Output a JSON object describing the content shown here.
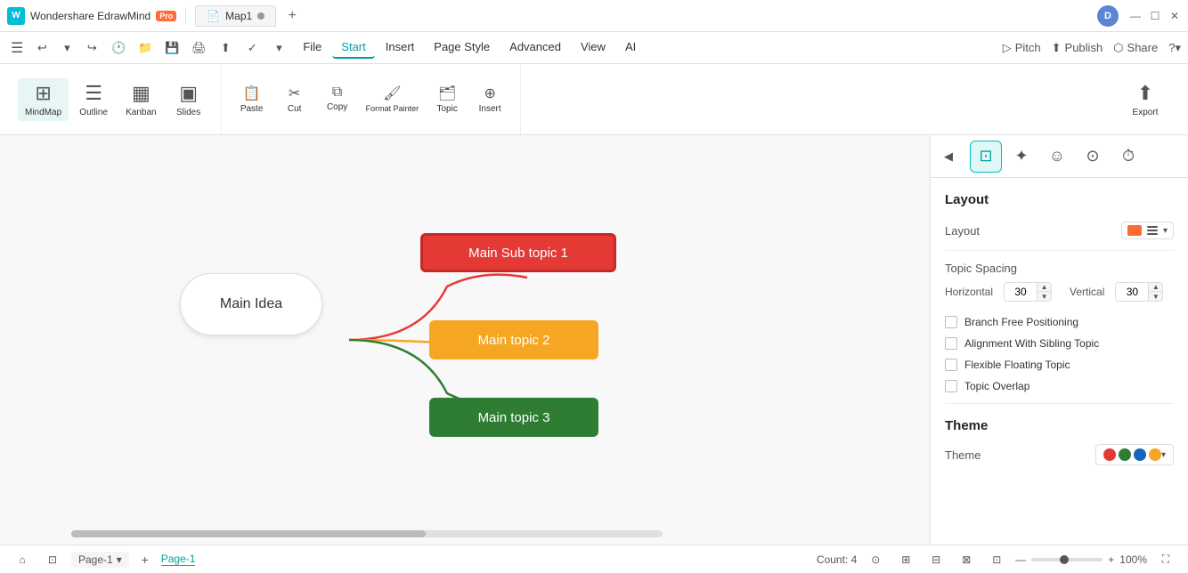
{
  "app": {
    "name": "Wondershare EdrawMind",
    "badge": "Pro",
    "file_tab": "Map1",
    "user_initial": "D"
  },
  "title_bar": {
    "win_minimize": "—",
    "win_maximize": "☐",
    "win_close": "✕"
  },
  "nav": {
    "items": [
      "File",
      "Start",
      "Insert",
      "Page Style",
      "Advanced",
      "View",
      "AI"
    ],
    "active": "Start",
    "actions": {
      "pitch": "Pitch",
      "publish": "Publish",
      "share": "Share"
    }
  },
  "ribbon": {
    "view_group": [
      {
        "id": "mindmap",
        "label": "MindMap",
        "icon": "⊞"
      },
      {
        "id": "outline",
        "label": "Outline",
        "icon": "☰"
      },
      {
        "id": "kanban",
        "label": "Kanban",
        "icon": "▦"
      },
      {
        "id": "slides",
        "label": "Slides",
        "icon": "▣"
      }
    ],
    "edit_group": [
      {
        "id": "paste",
        "label": "Paste",
        "icon": "📋"
      },
      {
        "id": "cut",
        "label": "Cut",
        "icon": "✂"
      },
      {
        "id": "copy",
        "label": "Copy",
        "icon": "⧉"
      },
      {
        "id": "format_painter",
        "label": "Format Painter",
        "icon": "🖌"
      },
      {
        "id": "topic",
        "label": "Topic",
        "icon": "🗂"
      },
      {
        "id": "insert",
        "label": "Insert",
        "icon": "⊕"
      }
    ],
    "export": "Export"
  },
  "canvas": {
    "nodes": {
      "main_idea": "Main Idea",
      "sub1": "Main Sub topic 1",
      "sub2": "Main topic 2",
      "sub3": "Main topic 3"
    }
  },
  "right_panel": {
    "tabs": [
      {
        "id": "layout",
        "icon": "⊡",
        "active": true
      },
      {
        "id": "ai",
        "icon": "✦"
      },
      {
        "id": "emoji",
        "icon": "☺"
      },
      {
        "id": "shield",
        "icon": "⊙"
      },
      {
        "id": "clock",
        "icon": "⏱"
      }
    ],
    "layout_section": {
      "title": "Layout",
      "layout_label": "Layout",
      "spacing_title": "Topic Spacing",
      "horizontal_label": "Horizontal",
      "horizontal_value": "30",
      "vertical_label": "Vertical",
      "vertical_value": "30",
      "checkboxes": [
        {
          "id": "branch_free",
          "label": "Branch Free Positioning",
          "checked": false
        },
        {
          "id": "alignment",
          "label": "Alignment With Sibling Topic",
          "checked": false
        },
        {
          "id": "flexible",
          "label": "Flexible Floating Topic",
          "checked": false
        },
        {
          "id": "topic_overlap",
          "label": "Topic Overlap",
          "checked": false
        }
      ]
    },
    "theme_section": {
      "title": "Theme",
      "theme_label": "Theme",
      "colors": [
        "#e53935",
        "#2e7d32",
        "#1565c0",
        "#f5a623"
      ]
    }
  },
  "status_bar": {
    "page_label": "Page-1",
    "active_page": "Page-1",
    "count_label": "Count: 4",
    "zoom_level": "100%",
    "zoom_in": "+",
    "zoom_out": "—"
  }
}
